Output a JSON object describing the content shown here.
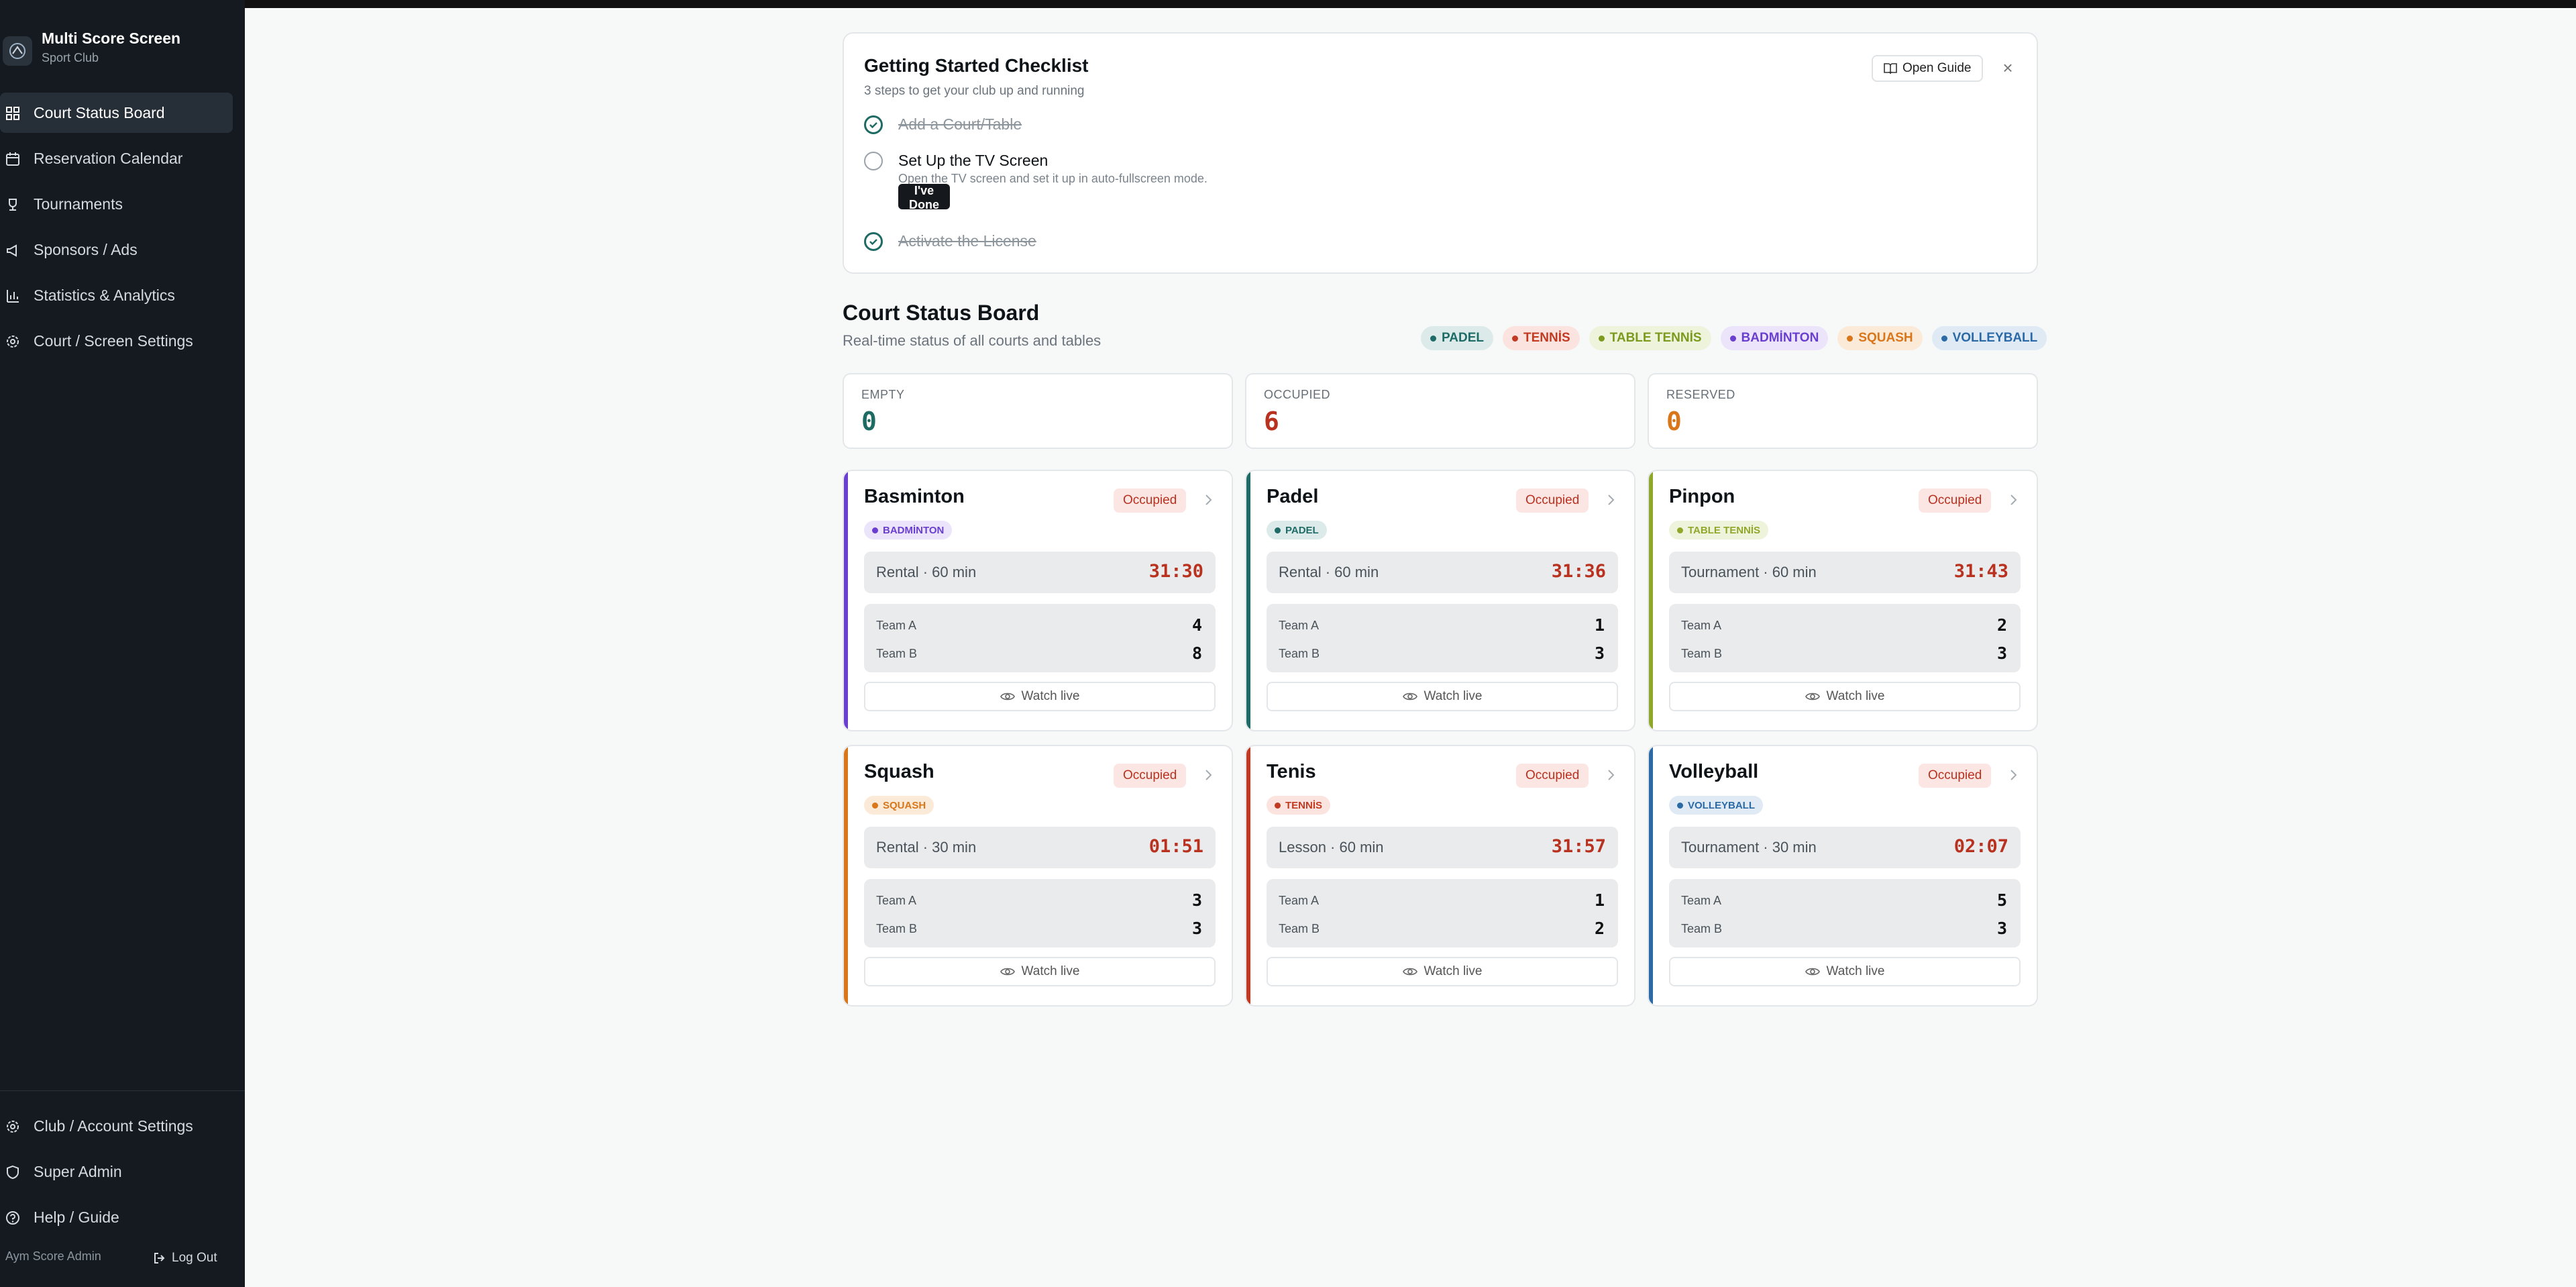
{
  "brand": {
    "title": "Multi Score Screen",
    "subtitle": "Sport Club"
  },
  "nav": [
    {
      "label": "Court Status Board",
      "icon": "grid-icon",
      "active": true
    },
    {
      "label": "Reservation Calendar",
      "icon": "calendar-icon"
    },
    {
      "label": "Tournaments",
      "icon": "trophy-icon"
    },
    {
      "label": "Sponsors / Ads",
      "icon": "megaphone-icon"
    },
    {
      "label": "Statistics & Analytics",
      "icon": "bar-chart-icon"
    },
    {
      "label": "Court / Screen Settings",
      "icon": "gear-icon"
    }
  ],
  "nav_bottom": [
    {
      "label": "Club / Account Settings",
      "icon": "gear-icon"
    },
    {
      "label": "Super Admin",
      "icon": "shield-icon"
    },
    {
      "label": "Help / Guide",
      "icon": "help-circle-icon"
    }
  ],
  "footer": {
    "user": "Aym Score Admin",
    "logout": "Log Out"
  },
  "checklist": {
    "title": "Getting Started Checklist",
    "subtitle": "3 steps to get your club up and running",
    "open_guide": "Open Guide",
    "close": "×",
    "steps": [
      {
        "label": "Add a Court/Table",
        "done": true
      },
      {
        "label": "Set Up the TV Screen",
        "desc": "Open the TV screen and set it up in auto-fullscreen mode.",
        "button": "I've Done This",
        "done": false
      },
      {
        "label": "Activate the License",
        "done": true
      }
    ]
  },
  "board": {
    "title": "Court Status Board",
    "subtitle": "Real-time status of all courts and tables",
    "tags": [
      {
        "label": "PADEL",
        "color": "#1f6b67",
        "bg": "#dcebe9"
      },
      {
        "label": "TENNİS",
        "color": "#c23a22",
        "bg": "#fbe4df"
      },
      {
        "label": "TABLE TENNİS",
        "color": "#7b9a1e",
        "bg": "#eef3dc"
      },
      {
        "label": "BADMİNTON",
        "color": "#6a3fd0",
        "bg": "#ebe4fb"
      },
      {
        "label": "SQUASH",
        "color": "#d9761a",
        "bg": "#fcead9"
      },
      {
        "label": "VOLLEYBALL",
        "color": "#2b6aa6",
        "bg": "#dfeaf5"
      }
    ]
  },
  "stats": [
    {
      "label": "EMPTY",
      "value": "0",
      "color": "#1d6b63"
    },
    {
      "label": "OCCUPIED",
      "value": "6",
      "color": "#b8321f"
    },
    {
      "label": "RESERVED",
      "value": "0",
      "color": "#d9761a"
    }
  ],
  "courts": [
    {
      "name": "Basminton",
      "status": "Occupied",
      "sport": "BADMİNTON",
      "accent": "#6a3fd0",
      "tag_bg": "#ebe4fb",
      "session": "Rental · 60 min",
      "timer": "31:30",
      "team_a": "Team A",
      "team_b": "Team B",
      "score_a": "4",
      "score_b": "8",
      "watch": "Watch live"
    },
    {
      "name": "Padel",
      "status": "Occupied",
      "sport": "PADEL",
      "accent": "#1f6b67",
      "tag_bg": "#dcebe9",
      "session": "Rental · 60 min",
      "timer": "31:36",
      "team_a": "Team A",
      "team_b": "Team B",
      "score_a": "1",
      "score_b": "3",
      "watch": "Watch live"
    },
    {
      "name": "Pinpon",
      "status": "Occupied",
      "sport": "TABLE TENNİS",
      "accent": "#8fa82a",
      "tag_bg": "#eef3dc",
      "session": "Tournament · 60 min",
      "timer": "31:43",
      "team_a": "Team A",
      "team_b": "Team B",
      "score_a": "2",
      "score_b": "3",
      "watch": "Watch live"
    },
    {
      "name": "Squash",
      "status": "Occupied",
      "sport": "SQUASH",
      "accent": "#d9761a",
      "tag_bg": "#fcead9",
      "session": "Rental · 30 min",
      "timer": "01:51",
      "team_a": "Team A",
      "team_b": "Team B",
      "score_a": "3",
      "score_b": "3",
      "watch": "Watch live"
    },
    {
      "name": "Tenis",
      "status": "Occupied",
      "sport": "TENNİS",
      "accent": "#c23a22",
      "tag_bg": "#fbe4df",
      "session": "Lesson · 60 min",
      "timer": "31:57",
      "team_a": "Team A",
      "team_b": "Team B",
      "score_a": "1",
      "score_b": "2",
      "watch": "Watch live"
    },
    {
      "name": "Volleyball",
      "status": "Occupied",
      "sport": "VOLLEYBALL",
      "accent": "#2b6aa6",
      "tag_bg": "#dfeaf5",
      "session": "Tournament · 30 min",
      "timer": "02:07",
      "team_a": "Team A",
      "team_b": "Team B",
      "score_a": "5",
      "score_b": "3",
      "watch": "Watch live"
    }
  ]
}
